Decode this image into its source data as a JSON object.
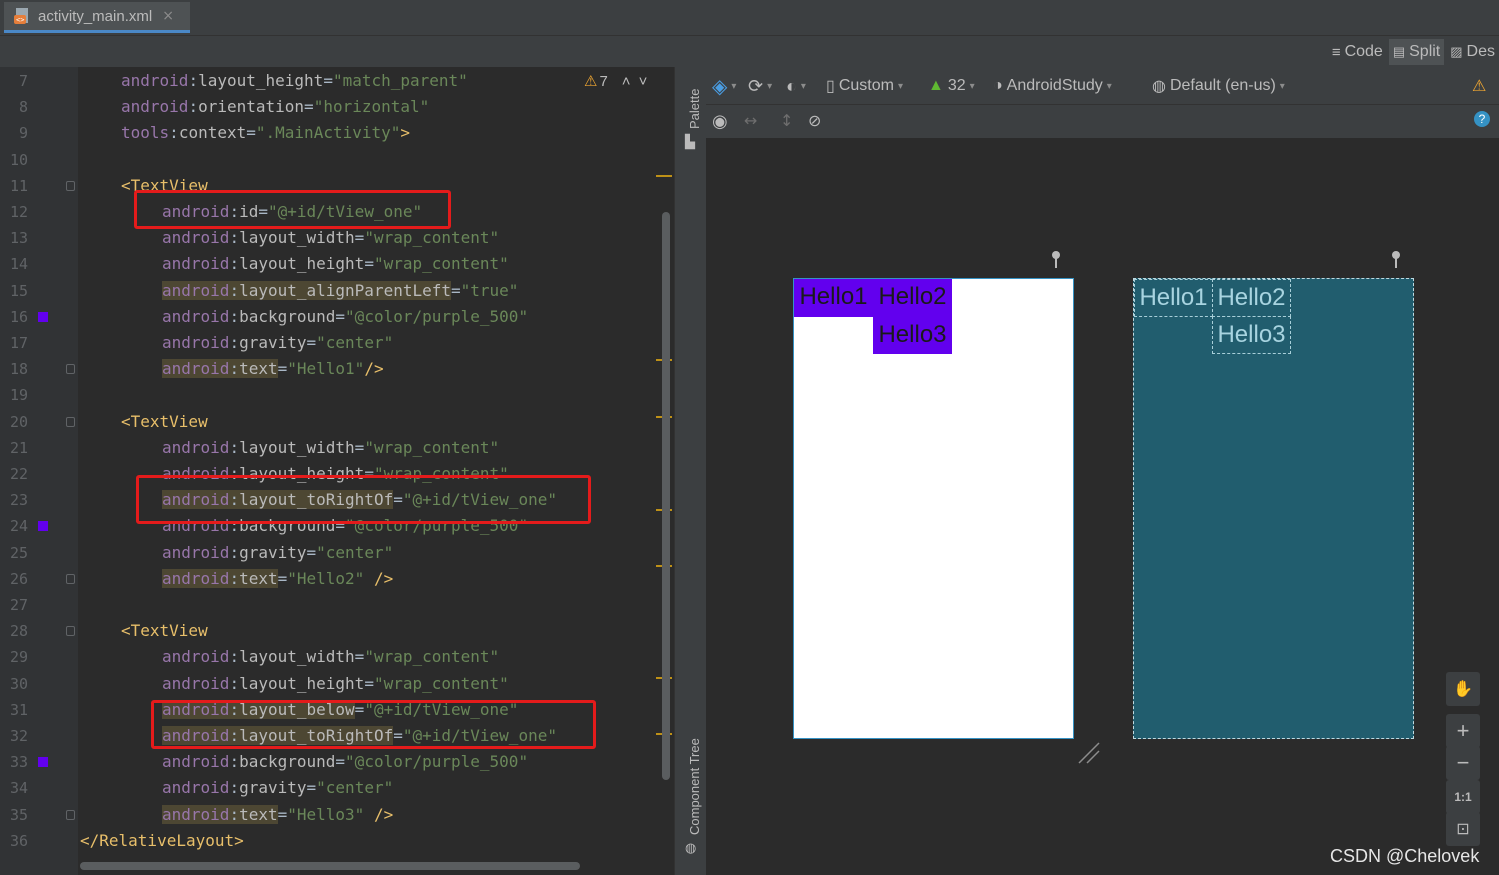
{
  "tab": {
    "label": "activity_main.xml",
    "close": "×"
  },
  "modes": {
    "code": "Code",
    "split": "Split",
    "design": "Des"
  },
  "editor": {
    "warnings": "7",
    "lines": [
      {
        "n": "7",
        "indent": 2,
        "parts": [
          {
            "c": "ns",
            "t": "android"
          },
          {
            "c": "plain",
            "t": ":"
          },
          {
            "c": "attr",
            "t": "layout_height"
          },
          {
            "c": "plain",
            "t": "="
          },
          {
            "c": "val",
            "t": "\"match_parent\""
          }
        ]
      },
      {
        "n": "8",
        "indent": 2,
        "parts": [
          {
            "c": "ns",
            "t": "android"
          },
          {
            "c": "plain",
            "t": ":"
          },
          {
            "c": "attr",
            "t": "orientation"
          },
          {
            "c": "plain",
            "t": "="
          },
          {
            "c": "val",
            "t": "\"horizontal\""
          }
        ]
      },
      {
        "n": "9",
        "indent": 2,
        "parts": [
          {
            "c": "ns",
            "t": "tools"
          },
          {
            "c": "plain",
            "t": ":"
          },
          {
            "c": "attr",
            "t": "context"
          },
          {
            "c": "plain",
            "t": "="
          },
          {
            "c": "val",
            "t": "\".MainActivity\""
          },
          {
            "c": "tag",
            "t": ">"
          }
        ]
      },
      {
        "n": "10",
        "indent": 0,
        "parts": []
      },
      {
        "n": "11",
        "indent": 2,
        "parts": [
          {
            "c": "tag",
            "t": "<TextView"
          }
        ]
      },
      {
        "n": "12",
        "indent": 4,
        "parts": [
          {
            "c": "ns",
            "t": "android"
          },
          {
            "c": "plain",
            "t": ":"
          },
          {
            "c": "attr",
            "t": "id"
          },
          {
            "c": "plain",
            "t": "="
          },
          {
            "c": "val",
            "t": "\"@+id/tView_one\""
          }
        ]
      },
      {
        "n": "13",
        "indent": 4,
        "parts": [
          {
            "c": "ns",
            "t": "android"
          },
          {
            "c": "plain",
            "t": ":"
          },
          {
            "c": "attr",
            "t": "layout_width"
          },
          {
            "c": "plain",
            "t": "="
          },
          {
            "c": "val",
            "t": "\"wrap_content\""
          }
        ]
      },
      {
        "n": "14",
        "indent": 4,
        "parts": [
          {
            "c": "ns",
            "t": "android"
          },
          {
            "c": "plain",
            "t": ":"
          },
          {
            "c": "attr",
            "t": "layout_height"
          },
          {
            "c": "plain",
            "t": "="
          },
          {
            "c": "val",
            "t": "\"wrap_content\""
          }
        ]
      },
      {
        "n": "15",
        "indent": 4,
        "hl": true,
        "parts": [
          {
            "c": "ns",
            "t": "android"
          },
          {
            "c": "plain",
            "t": ":"
          },
          {
            "c": "attr",
            "t": "layout_alignParentLeft"
          },
          {
            "c": "plain",
            "t": "="
          },
          {
            "c": "val",
            "t": "\"true\""
          }
        ]
      },
      {
        "n": "16",
        "indent": 4,
        "swatch": true,
        "parts": [
          {
            "c": "ns",
            "t": "android"
          },
          {
            "c": "plain",
            "t": ":"
          },
          {
            "c": "attr",
            "t": "background"
          },
          {
            "c": "plain",
            "t": "="
          },
          {
            "c": "val",
            "t": "\"@color/purple_500\""
          }
        ]
      },
      {
        "n": "17",
        "indent": 4,
        "parts": [
          {
            "c": "ns",
            "t": "android"
          },
          {
            "c": "plain",
            "t": ":"
          },
          {
            "c": "attr",
            "t": "gravity"
          },
          {
            "c": "plain",
            "t": "="
          },
          {
            "c": "val",
            "t": "\"center\""
          }
        ]
      },
      {
        "n": "18",
        "indent": 4,
        "hl": true,
        "parts": [
          {
            "c": "ns",
            "t": "android"
          },
          {
            "c": "plain",
            "t": ":"
          },
          {
            "c": "attr",
            "t": "text"
          },
          {
            "c": "plain",
            "t": "="
          },
          {
            "c": "val",
            "t": "\"Hello1\""
          },
          {
            "c": "tag",
            "t": "/>"
          }
        ]
      },
      {
        "n": "19",
        "indent": 0,
        "parts": []
      },
      {
        "n": "20",
        "indent": 2,
        "parts": [
          {
            "c": "tag",
            "t": "<TextView"
          }
        ]
      },
      {
        "n": "21",
        "indent": 4,
        "parts": [
          {
            "c": "ns",
            "t": "android"
          },
          {
            "c": "plain",
            "t": ":"
          },
          {
            "c": "attr",
            "t": "layout_width"
          },
          {
            "c": "plain",
            "t": "="
          },
          {
            "c": "val",
            "t": "\"wrap_content\""
          }
        ]
      },
      {
        "n": "22",
        "indent": 4,
        "parts": [
          {
            "c": "ns",
            "t": "android"
          },
          {
            "c": "plain",
            "t": ":"
          },
          {
            "c": "attr",
            "t": "layout_height"
          },
          {
            "c": "plain",
            "t": "="
          },
          {
            "c": "val",
            "t": "\"wrap_content\""
          }
        ]
      },
      {
        "n": "23",
        "indent": 4,
        "hl": true,
        "parts": [
          {
            "c": "ns",
            "t": "android"
          },
          {
            "c": "plain",
            "t": ":"
          },
          {
            "c": "attr",
            "t": "layout_toRightOf"
          },
          {
            "c": "plain",
            "t": "="
          },
          {
            "c": "val",
            "t": "\"@+id/tView_one\""
          }
        ]
      },
      {
        "n": "24",
        "indent": 4,
        "swatch": true,
        "parts": [
          {
            "c": "ns",
            "t": "android"
          },
          {
            "c": "plain",
            "t": ":"
          },
          {
            "c": "attr",
            "t": "background"
          },
          {
            "c": "plain",
            "t": "="
          },
          {
            "c": "val",
            "t": "\"@color/purple_500\""
          }
        ]
      },
      {
        "n": "25",
        "indent": 4,
        "parts": [
          {
            "c": "ns",
            "t": "android"
          },
          {
            "c": "plain",
            "t": ":"
          },
          {
            "c": "attr",
            "t": "gravity"
          },
          {
            "c": "plain",
            "t": "="
          },
          {
            "c": "val",
            "t": "\"center\""
          }
        ]
      },
      {
        "n": "26",
        "indent": 4,
        "hl": true,
        "parts": [
          {
            "c": "ns",
            "t": "android"
          },
          {
            "c": "plain",
            "t": ":"
          },
          {
            "c": "attr",
            "t": "text"
          },
          {
            "c": "plain",
            "t": "="
          },
          {
            "c": "val",
            "t": "\"Hello2\""
          },
          {
            "c": "tag",
            "t": " />"
          }
        ]
      },
      {
        "n": "27",
        "indent": 0,
        "parts": []
      },
      {
        "n": "28",
        "indent": 2,
        "parts": [
          {
            "c": "tag",
            "t": "<TextView"
          }
        ]
      },
      {
        "n": "29",
        "indent": 4,
        "parts": [
          {
            "c": "ns",
            "t": "android"
          },
          {
            "c": "plain",
            "t": ":"
          },
          {
            "c": "attr",
            "t": "layout_width"
          },
          {
            "c": "plain",
            "t": "="
          },
          {
            "c": "val",
            "t": "\"wrap_content\""
          }
        ]
      },
      {
        "n": "30",
        "indent": 4,
        "parts": [
          {
            "c": "ns",
            "t": "android"
          },
          {
            "c": "plain",
            "t": ":"
          },
          {
            "c": "attr",
            "t": "layout_height"
          },
          {
            "c": "plain",
            "t": "="
          },
          {
            "c": "val",
            "t": "\"wrap_content\""
          }
        ]
      },
      {
        "n": "31",
        "indent": 4,
        "hl": true,
        "parts": [
          {
            "c": "ns",
            "t": "android"
          },
          {
            "c": "plain",
            "t": ":"
          },
          {
            "c": "attr",
            "t": "layout_below"
          },
          {
            "c": "plain",
            "t": "="
          },
          {
            "c": "val",
            "t": "\"@+id/tView_one\""
          }
        ]
      },
      {
        "n": "32",
        "indent": 4,
        "hl": true,
        "parts": [
          {
            "c": "ns",
            "t": "android"
          },
          {
            "c": "plain",
            "t": ":"
          },
          {
            "c": "attr",
            "t": "layout_toRightOf"
          },
          {
            "c": "plain",
            "t": "="
          },
          {
            "c": "val",
            "t": "\"@+id/tView_one\""
          }
        ]
      },
      {
        "n": "33",
        "indent": 4,
        "swatch": true,
        "parts": [
          {
            "c": "ns",
            "t": "android"
          },
          {
            "c": "plain",
            "t": ":"
          },
          {
            "c": "attr",
            "t": "background"
          },
          {
            "c": "plain",
            "t": "="
          },
          {
            "c": "val",
            "t": "\"@color/purple_500\""
          }
        ]
      },
      {
        "n": "34",
        "indent": 4,
        "parts": [
          {
            "c": "ns",
            "t": "android"
          },
          {
            "c": "plain",
            "t": ":"
          },
          {
            "c": "attr",
            "t": "gravity"
          },
          {
            "c": "plain",
            "t": "="
          },
          {
            "c": "val",
            "t": "\"center\""
          }
        ]
      },
      {
        "n": "35",
        "indent": 4,
        "hl": true,
        "parts": [
          {
            "c": "ns",
            "t": "android"
          },
          {
            "c": "plain",
            "t": ":"
          },
          {
            "c": "attr",
            "t": "text"
          },
          {
            "c": "plain",
            "t": "="
          },
          {
            "c": "val",
            "t": "\"Hello3\""
          },
          {
            "c": "tag",
            "t": " />"
          }
        ]
      },
      {
        "n": "36",
        "indent": 0,
        "parts": [
          {
            "c": "tag",
            "t": "</RelativeLayout>"
          }
        ]
      }
    ]
  },
  "side_panels": {
    "palette": "Palette",
    "component_tree": "Component Tree"
  },
  "design_toolbar": {
    "device": "Custom",
    "api": "32",
    "theme": "AndroidStudy",
    "locale": "Default (en-us)"
  },
  "preview": {
    "hello1": "Hello1",
    "hello2": "Hello2",
    "hello3": "Hello3"
  },
  "zoom": {
    "one_to_one": "1:1"
  },
  "colors": {
    "purple_500": "#6200ee",
    "blueprint": "#215d6e",
    "highlight_box": "#e41b1b"
  },
  "watermark": "CSDN @Chelovek"
}
